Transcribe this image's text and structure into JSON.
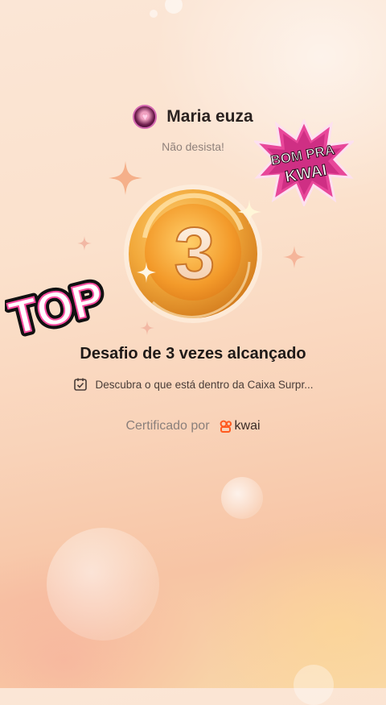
{
  "user": {
    "name": "Maria euza",
    "subtitle": "Não desista!"
  },
  "medal": {
    "number": "3"
  },
  "achievement": {
    "title": "Desafio de 3 vezes alcançado",
    "task_icon": "calendar-check-icon",
    "task_text": "Descubra o que está dentro da Caixa Surpr..."
  },
  "certificate": {
    "label": "Certificado por",
    "brand": "kwai"
  },
  "stickers": {
    "top_text": "TOP",
    "bom_line1": "BOM PRA",
    "bom_line2": "KWAI"
  },
  "colors": {
    "medal_gold": "#f2a93b",
    "sticker_pink": "#e8479a",
    "kwai_orange": "#ff5a1f"
  }
}
